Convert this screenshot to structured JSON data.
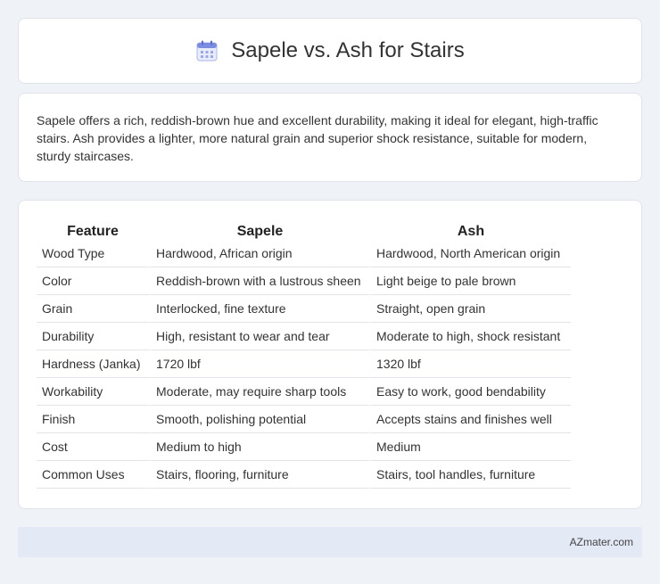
{
  "header": {
    "title": "Sapele vs. Ash for Stairs",
    "icon": "calendar-icon"
  },
  "summary": {
    "text": "Sapele offers a rich, reddish-brown hue and excellent durability, making it ideal for elegant, high-traffic stairs. Ash provides a lighter, more natural grain and superior shock resistance, suitable for modern, sturdy staircases."
  },
  "table": {
    "headers": [
      "Feature",
      "Sapele",
      "Ash"
    ],
    "rows": [
      [
        "Wood Type",
        "Hardwood, African origin",
        "Hardwood, North American origin"
      ],
      [
        "Color",
        "Reddish-brown with a lustrous sheen",
        "Light beige to pale brown"
      ],
      [
        "Grain",
        "Interlocked, fine texture",
        "Straight, open grain"
      ],
      [
        "Durability",
        "High, resistant to wear and tear",
        "Moderate to high, shock resistant"
      ],
      [
        "Hardness (Janka)",
        "1720 lbf",
        "1320 lbf"
      ],
      [
        "Workability",
        "Moderate, may require sharp tools",
        "Easy to work, good bendability"
      ],
      [
        "Finish",
        "Smooth, polishing potential",
        "Accepts stains and finishes well"
      ],
      [
        "Cost",
        "Medium to high",
        "Medium"
      ],
      [
        "Common Uses",
        "Stairs, flooring, furniture",
        "Stairs, tool handles, furniture"
      ]
    ]
  },
  "footer": {
    "site": "AZmater.com"
  },
  "colors": {
    "background": "#eff2f7",
    "card": "#ffffff",
    "footer_bg": "#e3e9f5",
    "icon_accent": "#7b8de0"
  }
}
